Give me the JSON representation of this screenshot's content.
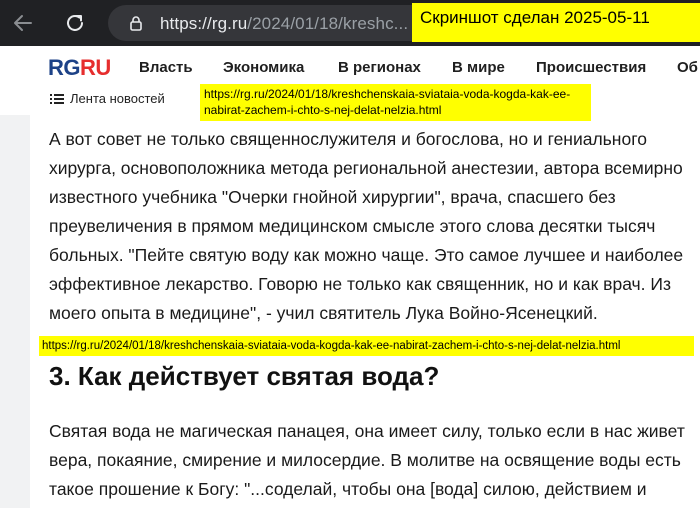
{
  "browser": {
    "url_host": "https://rg.ru",
    "url_path": "/2024/01/18/kreshc..."
  },
  "screenshot_note": "Скриншот сделан 2025-05-11",
  "site": {
    "logo_rg": "RG",
    "logo_ru": "RU",
    "nav": [
      "Власть",
      "Экономика",
      "В регионах",
      "В мире",
      "Происшествия",
      "Об"
    ],
    "newsfeed_label": "Лента новостей"
  },
  "url_annotation_1": "https://rg.ru/2024/01/18/kreshchenskaia-sviataia-voda-kogda-kak-ee-nabirat-zachem-i-chto-s-nej-delat-nelzia.html",
  "url_annotation_2": "https://rg.ru/2024/01/18/kreshchenskaia-sviataia-voda-kogda-kak-ee-nabirat-zachem-i-chto-s-nej-delat-nelzia.html",
  "article": {
    "paragraph_1": "А вот совет не только священнослужителя и богослова, но и гениального хирурга, основоположника метода региональной анестезии, автора всемирно известного учебника \"Очерки гнойной хирургии\", врача, спасшего без преувеличения в прямом медицинском смысле этого слова десятки тысяч больных. \"Пейте святую воду как можно чаще. Это самое лучшее и наиболее эффективное лекарство. Говорю не только как священник, но и как врач. Из моего опыта в медицине\", - учил святитель Лука Войно-Ясенецкий.",
    "heading": "3. Как действует святая вода?",
    "paragraph_2": "Святая вода не магическая панацея, она имеет силу, только если в нас живет вера, покаяние, смирение и милосердие. В молитве на освящение воды есть такое прошение к Богу: \"...соделай, чтобы она [вода] силою, действием и"
  }
}
